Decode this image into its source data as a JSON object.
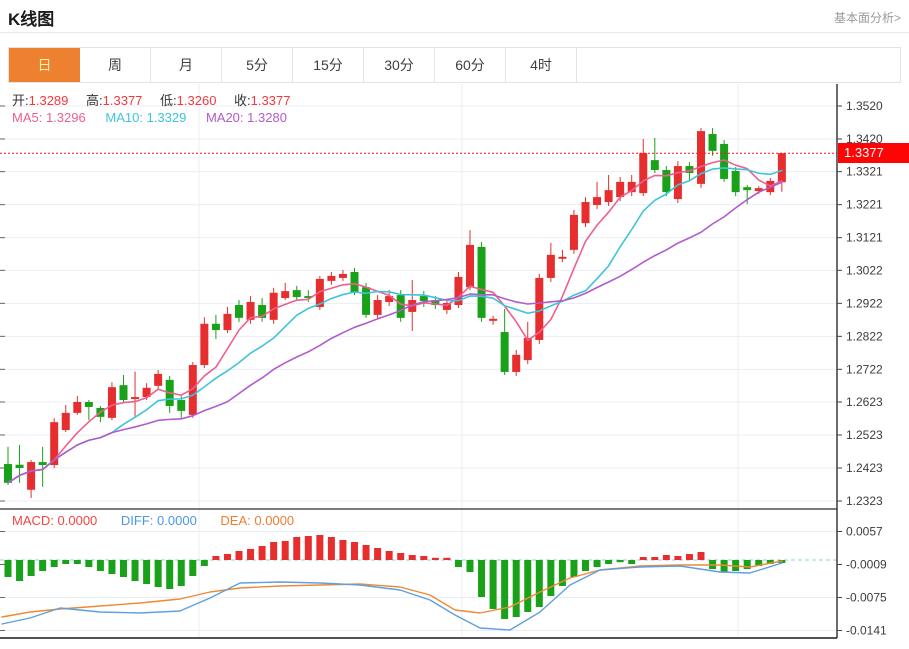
{
  "header": {
    "title": "K线图",
    "link": "基本面分析>"
  },
  "tabs": [
    {
      "label": "日",
      "active": true
    },
    {
      "label": "周",
      "active": false
    },
    {
      "label": "月",
      "active": false
    },
    {
      "label": "5分",
      "active": false
    },
    {
      "label": "15分",
      "active": false
    },
    {
      "label": "30分",
      "active": false
    },
    {
      "label": "60分",
      "active": false
    },
    {
      "label": "4时",
      "active": false
    }
  ],
  "legend": {
    "ohlc": [
      {
        "label": "开:",
        "value": "1.3289"
      },
      {
        "label": "高:",
        "value": "1.3377"
      },
      {
        "label": "低:",
        "value": "1.3260"
      },
      {
        "label": "收:",
        "value": "1.3377"
      }
    ],
    "ma": [
      {
        "label": "MA5:",
        "value": "1.3296",
        "color": "#ee5f90"
      },
      {
        "label": "MA10:",
        "value": "1.3329",
        "color": "#3ec4da"
      },
      {
        "label": "MA20:",
        "value": "1.3280",
        "color": "#b25bcb"
      }
    ],
    "macd": [
      {
        "label": "MACD:",
        "value": "0.0000",
        "color": "#f4453f"
      },
      {
        "label": "DIFF:",
        "value": "0.0000",
        "color": "#4a97e8"
      },
      {
        "label": "DEA:",
        "value": "0.0000",
        "color": "#f07c30"
      }
    ]
  },
  "price_tag": "1.3377",
  "colors": {
    "up": "#e62e2e",
    "down": "#19a219",
    "ma5": "#ee5f90",
    "ma10": "#3ec4da",
    "ma20": "#b25bcb",
    "diff": "#5f9fe0",
    "dea": "#ee8a35",
    "grid": "#e8eef5",
    "axis": "#2e2e2e",
    "tick_text": "#3d3d3d",
    "price_line": "#ff1414",
    "zero_dash": "#8fd3de",
    "tab_active": "#ee8130"
  },
  "chart_data": {
    "type": "candlestick+macd",
    "main": {
      "ylim": [
        1.2323,
        1.352
      ],
      "yticks": [
        1.352,
        1.342,
        1.3321,
        1.3221,
        1.3121,
        1.3022,
        1.2922,
        1.2822,
        1.2722,
        1.2623,
        1.2523,
        1.2423,
        1.2323
      ],
      "last_price": 1.3377,
      "ma_periods": [
        5,
        10,
        20
      ],
      "x_gridlines": [
        199,
        462,
        738
      ],
      "candles": [
        [
          1.2435,
          1.2487,
          1.2372,
          1.2378
        ],
        [
          1.2433,
          1.2493,
          1.2378,
          1.2423
        ],
        [
          1.2357,
          1.2447,
          1.2332,
          1.2441
        ],
        [
          1.2441,
          1.2487,
          1.2366,
          1.2432
        ],
        [
          1.2432,
          1.2574,
          1.2423,
          1.2562
        ],
        [
          1.2538,
          1.2614,
          1.2532,
          1.259
        ],
        [
          1.259,
          1.2641,
          1.2584,
          1.2623
        ],
        [
          1.2623,
          1.2629,
          1.2568,
          1.2608
        ],
        [
          1.2605,
          1.2611,
          1.2562,
          1.2578
        ],
        [
          1.2575,
          1.2683,
          1.2568,
          1.2668
        ],
        [
          1.2674,
          1.2705,
          1.2623,
          1.2629
        ],
        [
          1.2632,
          1.2715,
          1.2578,
          1.2638
        ],
        [
          1.2638,
          1.268,
          1.2629,
          1.2666
        ],
        [
          1.2672,
          1.272,
          1.2663,
          1.2708
        ],
        [
          1.269,
          1.2702,
          1.259,
          1.2611
        ],
        [
          1.2629,
          1.2641,
          1.2575,
          1.2596
        ],
        [
          1.2584,
          1.2744,
          1.2575,
          1.2735
        ],
        [
          1.2735,
          1.288,
          1.2726,
          1.286
        ],
        [
          1.286,
          1.2887,
          1.2814,
          1.2841
        ],
        [
          1.2841,
          1.2911,
          1.2832,
          1.289
        ],
        [
          1.2917,
          1.2932,
          1.2866,
          1.2878
        ],
        [
          1.2872,
          1.2944,
          1.286,
          1.2926
        ],
        [
          1.2917,
          1.2938,
          1.2866,
          1.2878
        ],
        [
          1.2872,
          1.2969,
          1.286,
          1.2954
        ],
        [
          1.2938,
          1.2984,
          1.2932,
          1.2959
        ],
        [
          1.2962,
          1.2975,
          1.2929,
          1.2941
        ],
        [
          1.2944,
          1.2962,
          1.2926,
          1.2938
        ],
        [
          1.2911,
          1.3005,
          1.2902,
          1.2996
        ],
        [
          1.299,
          1.3017,
          1.2978,
          1.3005
        ],
        [
          1.2999,
          1.3023,
          1.299,
          1.3011
        ],
        [
          1.3017,
          1.3029,
          1.2947,
          1.2956
        ],
        [
          1.2971,
          1.2984,
          1.2878,
          1.2887
        ],
        [
          1.2887,
          1.2947,
          1.2875,
          1.2932
        ],
        [
          1.2926,
          1.2962,
          1.2914,
          1.2944
        ],
        [
          1.2947,
          1.2962,
          1.2866,
          1.2878
        ],
        [
          1.2896,
          1.2993,
          1.2838,
          1.2932
        ],
        [
          1.2944,
          1.2959,
          1.2911,
          1.2929
        ],
        [
          1.2932,
          1.2944,
          1.2905,
          1.2917
        ],
        [
          1.2902,
          1.2935,
          1.289,
          1.2923
        ],
        [
          1.2917,
          1.3017,
          1.2908,
          1.3002
        ],
        [
          1.2971,
          1.3144,
          1.2962,
          1.3099
        ],
        [
          1.3093,
          1.3108,
          1.2866,
          1.2878
        ],
        [
          1.2869,
          1.2884,
          1.2857,
          1.2875
        ],
        [
          1.2835,
          1.2905,
          1.2705,
          1.2714
        ],
        [
          1.2714,
          1.2781,
          1.2702,
          1.2766
        ],
        [
          1.275,
          1.2866,
          1.2738,
          1.2817
        ],
        [
          1.2811,
          1.3011,
          1.2799,
          1.2999
        ],
        [
          1.2999,
          1.3105,
          1.2987,
          1.3069
        ],
        [
          1.3057,
          1.3084,
          1.3047,
          1.3063
        ],
        [
          1.3084,
          1.3205,
          1.3072,
          1.319
        ],
        [
          1.3165,
          1.3244,
          1.3153,
          1.3229
        ],
        [
          1.322,
          1.329,
          1.3208,
          1.3244
        ],
        [
          1.3229,
          1.3311,
          1.3217,
          1.3265
        ],
        [
          1.3244,
          1.3305,
          1.3232,
          1.329
        ],
        [
          1.3259,
          1.3311,
          1.3247,
          1.329
        ],
        [
          1.3256,
          1.342,
          1.3247,
          1.3377
        ],
        [
          1.3356,
          1.3423,
          1.3317,
          1.3326
        ],
        [
          1.3326,
          1.3338,
          1.3247,
          1.3259
        ],
        [
          1.3238,
          1.3353,
          1.3226,
          1.3338
        ],
        [
          1.3338,
          1.335,
          1.3296,
          1.3317
        ],
        [
          1.3284,
          1.3453,
          1.3272,
          1.3444
        ],
        [
          1.3435,
          1.3453,
          1.3369,
          1.3384
        ],
        [
          1.3405,
          1.3417,
          1.329,
          1.3299
        ],
        [
          1.3323,
          1.3335,
          1.3247,
          1.3259
        ],
        [
          1.3274,
          1.3281,
          1.3223,
          1.3265
        ],
        [
          1.3262,
          1.3277,
          1.3253,
          1.3271
        ],
        [
          1.3259,
          1.3302,
          1.325,
          1.3293
        ],
        [
          1.3289,
          1.3377,
          1.326,
          1.3377
        ]
      ]
    },
    "macd": {
      "yticks": [
        0.0057,
        -0.0009,
        -0.0075,
        -0.0141
      ],
      "histogram": [
        -0.0034,
        -0.0042,
        -0.0032,
        -0.0022,
        -0.0014,
        -0.0008,
        -0.0008,
        -0.0014,
        -0.0022,
        -0.0028,
        -0.0034,
        -0.0042,
        -0.0048,
        -0.0054,
        -0.0058,
        -0.0052,
        -0.0032,
        -0.0012,
        0.0008,
        0.0012,
        0.0018,
        0.0022,
        0.0028,
        0.0036,
        0.0038,
        0.0046,
        0.0048,
        0.005,
        0.0046,
        0.004,
        0.0036,
        0.003,
        0.0024,
        0.0018,
        0.0014,
        0.001,
        0.0008,
        0.0004,
        0.0002,
        -0.0014,
        -0.0024,
        -0.0074,
        -0.0098,
        -0.0118,
        -0.0114,
        -0.0104,
        -0.0094,
        -0.0072,
        -0.0052,
        -0.0034,
        -0.0022,
        -0.0014,
        -0.0008,
        -0.0004,
        -0.0008,
        0.0006,
        0.0006,
        0.001,
        0.0008,
        0.0012,
        0.0016,
        -0.0018,
        -0.0024,
        -0.0022,
        -0.0018,
        -0.0012,
        -0.0008,
        -0.0006
      ],
      "diff_line": [
        [
          2,
          -0.0128
        ],
        [
          30,
          -0.0116
        ],
        [
          60,
          -0.0096
        ],
        [
          100,
          -0.0104
        ],
        [
          140,
          -0.0106
        ],
        [
          180,
          -0.0102
        ],
        [
          210,
          -0.0076
        ],
        [
          240,
          -0.0046
        ],
        [
          280,
          -0.0044
        ],
        [
          320,
          -0.0046
        ],
        [
          360,
          -0.005
        ],
        [
          400,
          -0.006
        ],
        [
          430,
          -0.008
        ],
        [
          455,
          -0.011
        ],
        [
          480,
          -0.0136
        ],
        [
          510,
          -0.014
        ],
        [
          540,
          -0.0104
        ],
        [
          570,
          -0.005
        ],
        [
          600,
          -0.002
        ],
        [
          640,
          -0.0014
        ],
        [
          680,
          -0.0012
        ],
        [
          720,
          -0.0024
        ],
        [
          750,
          -0.0026
        ],
        [
          782,
          -0.0006
        ]
      ],
      "dea_line": [
        [
          2,
          -0.0114
        ],
        [
          30,
          -0.0104
        ],
        [
          60,
          -0.0098
        ],
        [
          100,
          -0.0092
        ],
        [
          140,
          -0.0086
        ],
        [
          180,
          -0.0078
        ],
        [
          210,
          -0.0064
        ],
        [
          240,
          -0.0056
        ],
        [
          280,
          -0.0052
        ],
        [
          320,
          -0.005
        ],
        [
          360,
          -0.0048
        ],
        [
          400,
          -0.0054
        ],
        [
          430,
          -0.007
        ],
        [
          455,
          -0.01
        ],
        [
          480,
          -0.0106
        ],
        [
          510,
          -0.0094
        ],
        [
          540,
          -0.0064
        ],
        [
          570,
          -0.0036
        ],
        [
          600,
          -0.002
        ],
        [
          640,
          -0.0012
        ],
        [
          680,
          -0.001
        ],
        [
          720,
          -0.001
        ],
        [
          750,
          -0.0014
        ],
        [
          782,
          -0.0002
        ]
      ]
    }
  }
}
